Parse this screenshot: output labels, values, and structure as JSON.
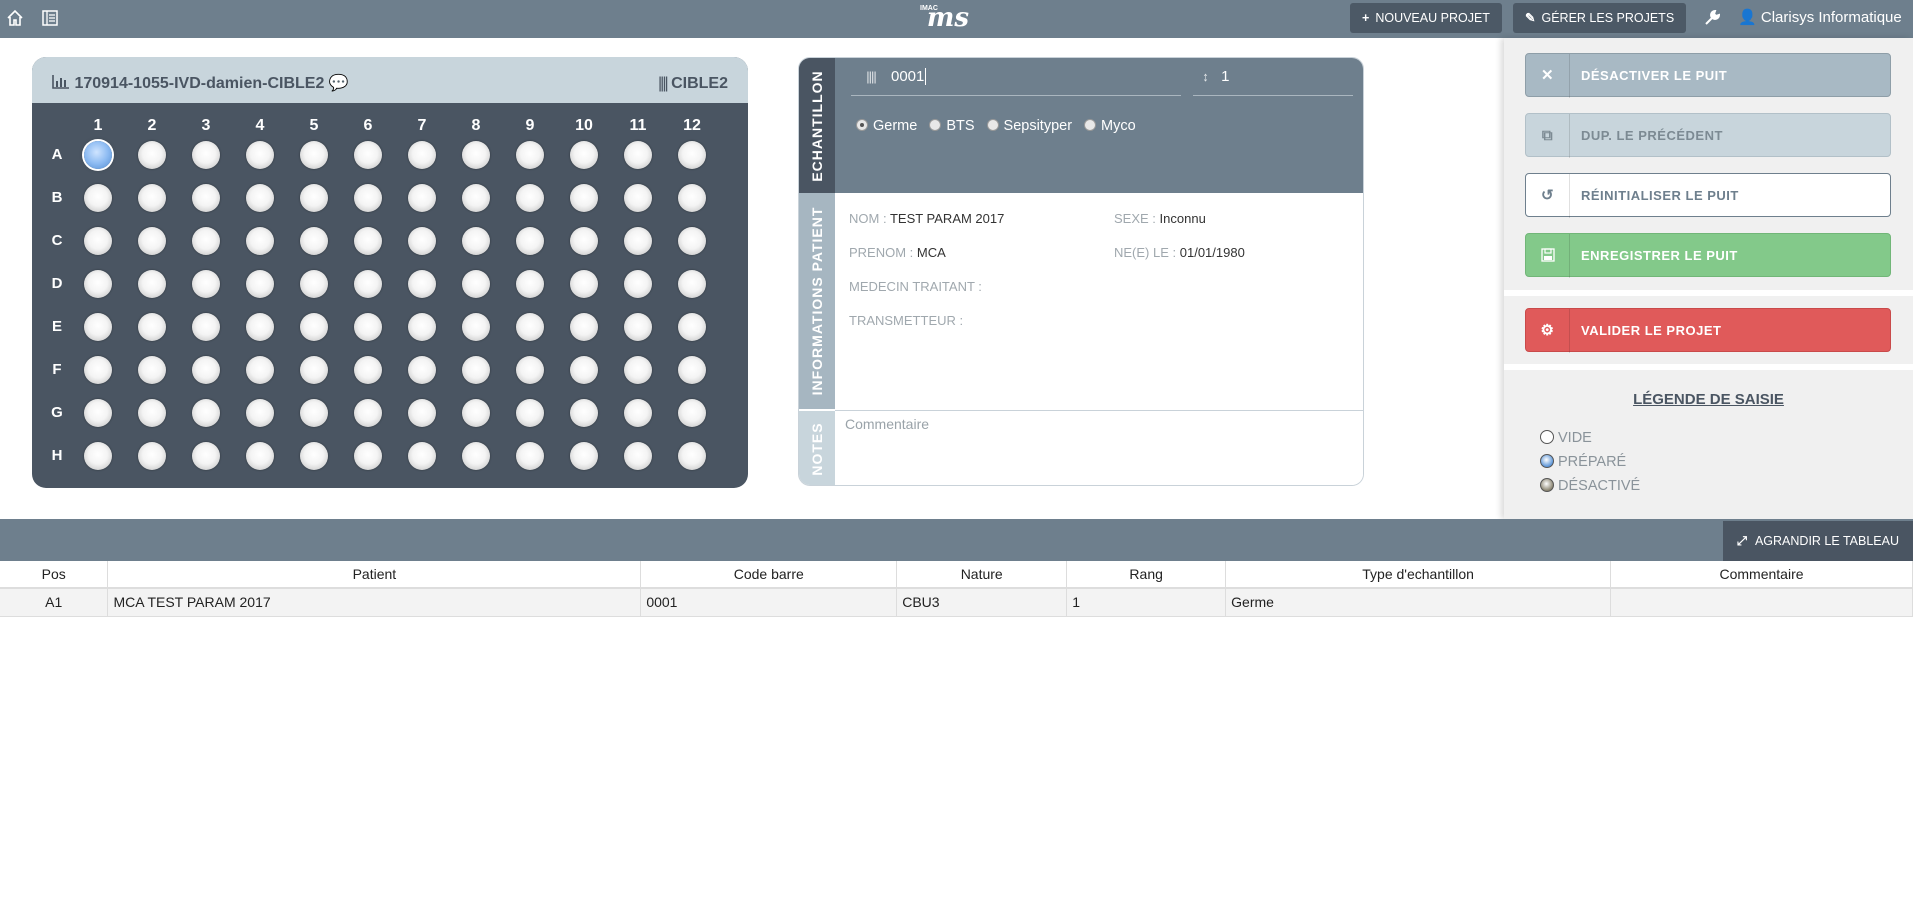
{
  "topbar": {
    "nouveau_projet": "NOUVEAU PROJET",
    "gerer_projets": "GÉRER LES PROJETS",
    "user": "Clarisys Informatique",
    "logo_text": "ms",
    "logo_small": "IMAC"
  },
  "plate": {
    "title": "170914-1055-IVD-damien-CIBLE2",
    "cible": "CIBLE2",
    "columns": [
      "1",
      "2",
      "3",
      "4",
      "5",
      "6",
      "7",
      "8",
      "9",
      "10",
      "11",
      "12"
    ],
    "rows": [
      "A",
      "B",
      "C",
      "D",
      "E",
      "F",
      "G",
      "H"
    ],
    "prepared_wells": [
      "A1"
    ]
  },
  "echantillon": {
    "section_label": "ECHANTILLON",
    "barcode_value": "0001",
    "rang_value": "1",
    "types": [
      "Germe",
      "BTS",
      "Sepsityper",
      "Myco"
    ],
    "selected_type": "Germe"
  },
  "patient": {
    "section_label": "INFORMATIONS PATIENT",
    "nom_label": "NOM :",
    "nom": "TEST PARAM 2017",
    "sexe_label": "SEXE :",
    "sexe": "Inconnu",
    "prenom_label": "PRENOM :",
    "prenom": "MCA",
    "ne_label": "NE(E) LE :",
    "ne": "01/01/1980",
    "medecin_label": "MEDECIN TRAITANT :",
    "transmetteur_label": "TRANSMETTEUR :"
  },
  "notes": {
    "section_label": "NOTES",
    "placeholder": "Commentaire"
  },
  "actions": {
    "desactiver": "DÉSACTIVER LE PUIT",
    "dup": "DUP. LE PRÉCÉDENT",
    "reinit": "RÉINITIALISER LE PUIT",
    "enregistrer": "ENREGISTRER LE PUIT",
    "valider": "VALIDER LE PROJET"
  },
  "legend": {
    "title": "LÉGENDE DE SAISIE",
    "items": [
      {
        "label": "VIDE",
        "color": "#ffffff"
      },
      {
        "label": "PRÉPARÉ",
        "color": "#5b95d8"
      },
      {
        "label": "DÉSACTIVÉ",
        "color": "#8a8470"
      }
    ]
  },
  "table": {
    "expand_label": "AGRANDIR LE TABLEAU",
    "headers": [
      "Pos",
      "Patient",
      "Code barre",
      "Nature",
      "Rang",
      "Type d'echantillon",
      "Commentaire"
    ],
    "rows": [
      [
        "A1",
        "MCA TEST PARAM 2017",
        "0001",
        "CBU3",
        "1",
        "Germe",
        ""
      ]
    ]
  },
  "colors": {
    "header": "#6e7f8d",
    "plate": "#4a5562",
    "accent_green": "#83c98a",
    "accent_red": "#e05a5a"
  }
}
